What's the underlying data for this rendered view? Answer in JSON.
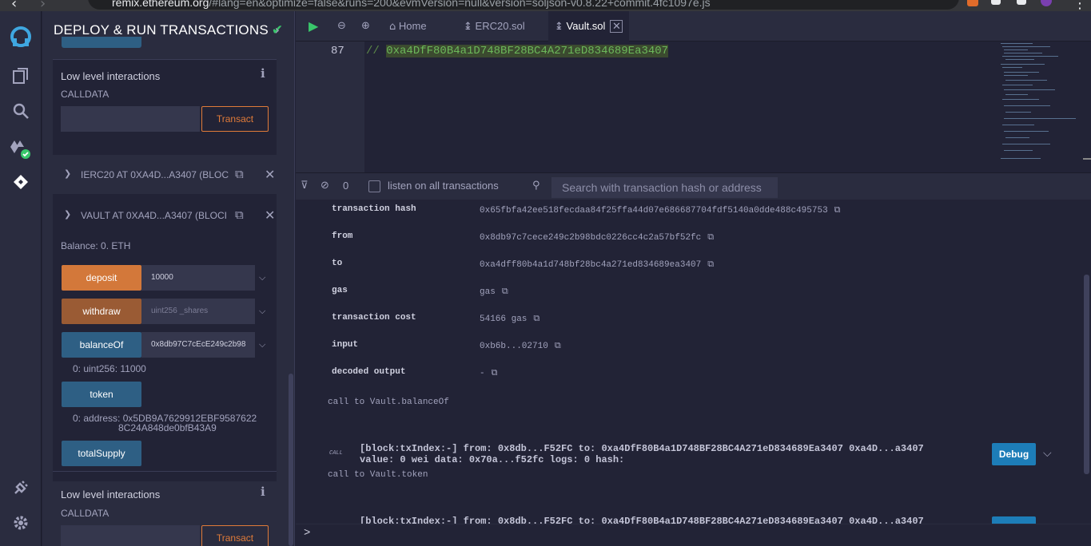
{
  "browser": {
    "url_host": "remix.ethereum.org",
    "url_rest": "/#lang=en&optimize=false&runs=200&evmVersion=null&version=soljson-v0.8.22+commit.4fc1097e.js"
  },
  "panel": {
    "title": "DEPLOY & RUN TRANSACTIONS",
    "low_level_title": "Low level interactions",
    "calldata_label": "CALLDATA",
    "transact_label": "Transact",
    "instances": [
      {
        "name": "IERC20 AT 0XA4D...A3407 (BLOC"
      },
      {
        "name": "VAULT AT 0XA4D...A3407 (BLOCI"
      }
    ],
    "balance": "Balance: 0. ETH",
    "functions": [
      {
        "label": "deposit",
        "value": "10000",
        "placeholder": ""
      },
      {
        "label": "withdraw",
        "value": "",
        "placeholder": "uint256 _shares"
      },
      {
        "label": "balanceOf",
        "value": "0x8db97C7cEcE249c2b98",
        "placeholder": ""
      },
      {
        "label": "token"
      },
      {
        "label": "totalSupply"
      }
    ],
    "balanceOf_result": "0: uint256: 11000",
    "token_result_line1": "0: address: 0x5DB9A7629912EBF9587622",
    "token_result_line2": "8C24A848de0bfB43A9",
    "low_level_title_2": "Low level interactions",
    "calldata_label_2": "CALLDATA",
    "transact_label_2": "Transact"
  },
  "tabs": {
    "home": "Home",
    "erc20": "ERC20.sol",
    "vault": "Vault.sol"
  },
  "editor": {
    "line_number": "87",
    "comment_prefix": "// ",
    "comment_highlight": "0xa4DfF80B4a1D748BF28BC4A271eD834689Ea3407"
  },
  "terminal_bar": {
    "count": "0",
    "listen_label": "listen on all transactions",
    "search_placeholder": "Search with transaction hash or address"
  },
  "terminal": {
    "rows": [
      {
        "key": "transaction hash",
        "value": "0x65fbfa42ee518fecdaa84f25ffa44d07e686687704fdf5140a0dde488c495753"
      },
      {
        "key": "from",
        "value": "0x8db97c7cece249c2b98bdc0226cc4c2a57bf52fc"
      },
      {
        "key": "to",
        "value": "0xa4dff80b4a1d748bf28bc4a271ed834689ea3407"
      },
      {
        "key": "gas",
        "value": " gas"
      },
      {
        "key": "transaction cost",
        "value": "54166 gas"
      },
      {
        "key": "input",
        "value": "0xb6b...02710"
      },
      {
        "key": "decoded output",
        "value": " -"
      }
    ],
    "note1": "call to Vault.balanceOf",
    "call_tag": "CALL",
    "tx1_line1": "[block:txIndex:-] from: 0x8db...F52FC to: 0xa4DfF80B4a1D748BF28BC4A271eD834689Ea3407 0xa4D...a3407",
    "tx1_line2": "value: 0 wei data: 0x70a...f52fc logs: 0 hash:",
    "debug_label": "Debug",
    "note2": "call to Vault.token",
    "tx2_line1": "[block:txIndex:-] from: 0x8db...F52FC to: 0xa4DfF80B4a1D748BF28BC4A271eD834689Ea3407 0xa4D...a3407"
  },
  "prompt": ">",
  "colors": {
    "deposit": "#d3783a",
    "withdraw": "#9a5b34",
    "call": "#2e5f84",
    "accent_green": "#39c66b"
  },
  "icons": [
    "remix-logo-icon",
    "file-explorer-icon",
    "search-icon",
    "solidity-compiler-icon",
    "deploy-icon",
    "plugin-icon",
    "settings-icon"
  ]
}
